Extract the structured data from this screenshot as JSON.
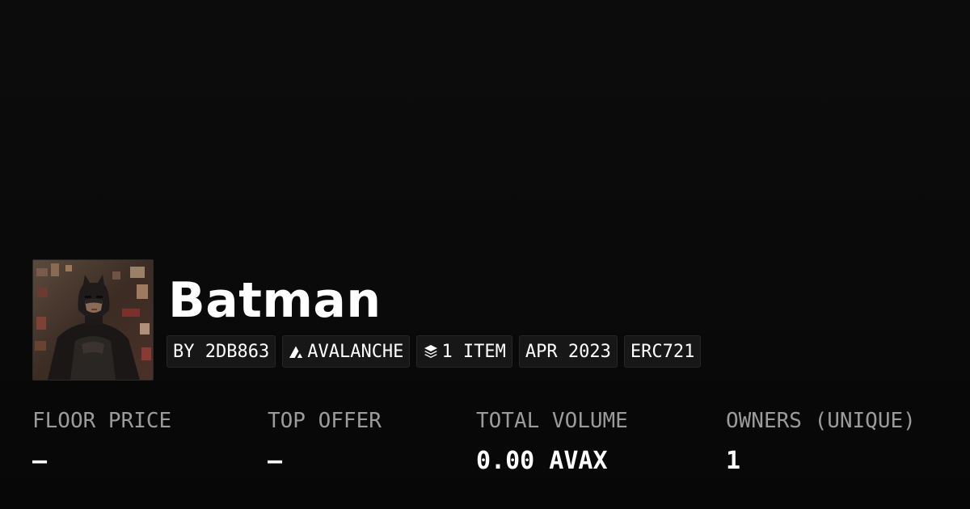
{
  "collection": {
    "name": "Batman",
    "image_alt": "Batman",
    "tags": {
      "creator": "BY 2DB863",
      "chain": "AVALANCHE",
      "items": "1 ITEM",
      "date": "APR 2023",
      "standard": "ERC721"
    }
  },
  "stats": {
    "floor_price": {
      "label": "FLOOR PRICE",
      "value": "—"
    },
    "top_offer": {
      "label": "TOP OFFER",
      "value": "—"
    },
    "total_volume": {
      "label": "TOTAL VOLUME",
      "value": "0.00 AVAX"
    },
    "owners": {
      "label": "OWNERS (UNIQUE)",
      "value": "1"
    }
  },
  "icons": {
    "chain": "avalanche-icon",
    "items": "layers-icon"
  },
  "colors": {
    "background": "#0a0a0a",
    "tag_background": "#171717",
    "label": "#9b9b9b",
    "text": "#ffffff"
  }
}
